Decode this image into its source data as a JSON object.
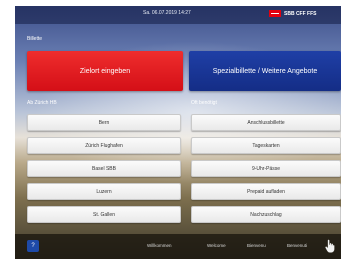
{
  "header": {
    "datetime": "Sa. 06.07.2019 14:27",
    "brand_text": "SBB CFF FFS"
  },
  "tickets_label": "Billette",
  "buttons": {
    "zielort": "Zielort eingeben",
    "special": "Spezialbillette / Weitere Angebote"
  },
  "left_section": {
    "label": "Ab Zürich HB",
    "items": [
      "Bern",
      "Zürich Flughafen",
      "Basel SBB",
      "Luzern",
      "St. Gallen"
    ]
  },
  "right_section": {
    "label": "Oft benötigt",
    "items": [
      "Anschlussbillette",
      "Tageskarten",
      "9-Uhr-Pässe",
      "Prepaid aufladen",
      "Nachzuschlag"
    ]
  },
  "footer": {
    "help": "?",
    "links": [
      "Willkommen",
      "Welcome",
      "Bienvenu",
      "Benvenuti"
    ]
  },
  "colors": {
    "red": "#e3000f",
    "blue": "#142d86"
  },
  "icons": {
    "language": "hand-pointer-icon"
  }
}
